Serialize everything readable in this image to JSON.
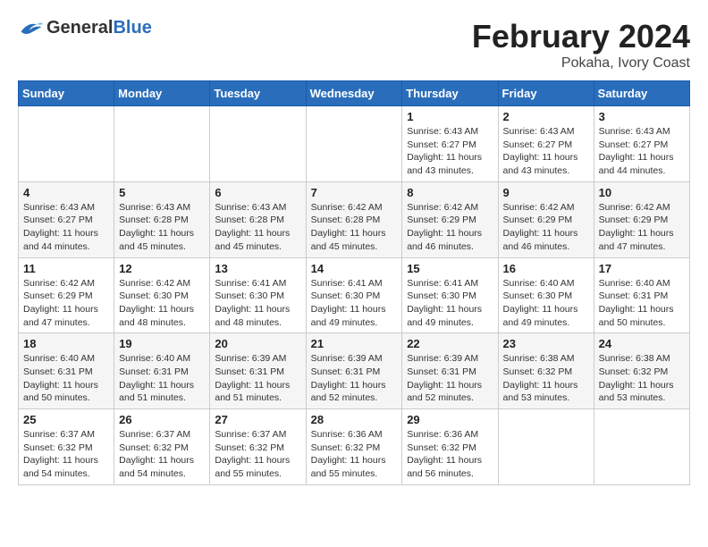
{
  "header": {
    "logo_general": "General",
    "logo_blue": "Blue",
    "month_title": "February 2024",
    "location": "Pokaha, Ivory Coast"
  },
  "calendar": {
    "days_of_week": [
      "Sunday",
      "Monday",
      "Tuesday",
      "Wednesday",
      "Thursday",
      "Friday",
      "Saturday"
    ],
    "weeks": [
      [
        {
          "day": "",
          "info": ""
        },
        {
          "day": "",
          "info": ""
        },
        {
          "day": "",
          "info": ""
        },
        {
          "day": "",
          "info": ""
        },
        {
          "day": "1",
          "info": "Sunrise: 6:43 AM\nSunset: 6:27 PM\nDaylight: 11 hours and 43 minutes."
        },
        {
          "day": "2",
          "info": "Sunrise: 6:43 AM\nSunset: 6:27 PM\nDaylight: 11 hours and 43 minutes."
        },
        {
          "day": "3",
          "info": "Sunrise: 6:43 AM\nSunset: 6:27 PM\nDaylight: 11 hours and 44 minutes."
        }
      ],
      [
        {
          "day": "4",
          "info": "Sunrise: 6:43 AM\nSunset: 6:27 PM\nDaylight: 11 hours and 44 minutes."
        },
        {
          "day": "5",
          "info": "Sunrise: 6:43 AM\nSunset: 6:28 PM\nDaylight: 11 hours and 45 minutes."
        },
        {
          "day": "6",
          "info": "Sunrise: 6:43 AM\nSunset: 6:28 PM\nDaylight: 11 hours and 45 minutes."
        },
        {
          "day": "7",
          "info": "Sunrise: 6:42 AM\nSunset: 6:28 PM\nDaylight: 11 hours and 45 minutes."
        },
        {
          "day": "8",
          "info": "Sunrise: 6:42 AM\nSunset: 6:29 PM\nDaylight: 11 hours and 46 minutes."
        },
        {
          "day": "9",
          "info": "Sunrise: 6:42 AM\nSunset: 6:29 PM\nDaylight: 11 hours and 46 minutes."
        },
        {
          "day": "10",
          "info": "Sunrise: 6:42 AM\nSunset: 6:29 PM\nDaylight: 11 hours and 47 minutes."
        }
      ],
      [
        {
          "day": "11",
          "info": "Sunrise: 6:42 AM\nSunset: 6:29 PM\nDaylight: 11 hours and 47 minutes."
        },
        {
          "day": "12",
          "info": "Sunrise: 6:42 AM\nSunset: 6:30 PM\nDaylight: 11 hours and 48 minutes."
        },
        {
          "day": "13",
          "info": "Sunrise: 6:41 AM\nSunset: 6:30 PM\nDaylight: 11 hours and 48 minutes."
        },
        {
          "day": "14",
          "info": "Sunrise: 6:41 AM\nSunset: 6:30 PM\nDaylight: 11 hours and 49 minutes."
        },
        {
          "day": "15",
          "info": "Sunrise: 6:41 AM\nSunset: 6:30 PM\nDaylight: 11 hours and 49 minutes."
        },
        {
          "day": "16",
          "info": "Sunrise: 6:40 AM\nSunset: 6:30 PM\nDaylight: 11 hours and 49 minutes."
        },
        {
          "day": "17",
          "info": "Sunrise: 6:40 AM\nSunset: 6:31 PM\nDaylight: 11 hours and 50 minutes."
        }
      ],
      [
        {
          "day": "18",
          "info": "Sunrise: 6:40 AM\nSunset: 6:31 PM\nDaylight: 11 hours and 50 minutes."
        },
        {
          "day": "19",
          "info": "Sunrise: 6:40 AM\nSunset: 6:31 PM\nDaylight: 11 hours and 51 minutes."
        },
        {
          "day": "20",
          "info": "Sunrise: 6:39 AM\nSunset: 6:31 PM\nDaylight: 11 hours and 51 minutes."
        },
        {
          "day": "21",
          "info": "Sunrise: 6:39 AM\nSunset: 6:31 PM\nDaylight: 11 hours and 52 minutes."
        },
        {
          "day": "22",
          "info": "Sunrise: 6:39 AM\nSunset: 6:31 PM\nDaylight: 11 hours and 52 minutes."
        },
        {
          "day": "23",
          "info": "Sunrise: 6:38 AM\nSunset: 6:32 PM\nDaylight: 11 hours and 53 minutes."
        },
        {
          "day": "24",
          "info": "Sunrise: 6:38 AM\nSunset: 6:32 PM\nDaylight: 11 hours and 53 minutes."
        }
      ],
      [
        {
          "day": "25",
          "info": "Sunrise: 6:37 AM\nSunset: 6:32 PM\nDaylight: 11 hours and 54 minutes."
        },
        {
          "day": "26",
          "info": "Sunrise: 6:37 AM\nSunset: 6:32 PM\nDaylight: 11 hours and 54 minutes."
        },
        {
          "day": "27",
          "info": "Sunrise: 6:37 AM\nSunset: 6:32 PM\nDaylight: 11 hours and 55 minutes."
        },
        {
          "day": "28",
          "info": "Sunrise: 6:36 AM\nSunset: 6:32 PM\nDaylight: 11 hours and 55 minutes."
        },
        {
          "day": "29",
          "info": "Sunrise: 6:36 AM\nSunset: 6:32 PM\nDaylight: 11 hours and 56 minutes."
        },
        {
          "day": "",
          "info": ""
        },
        {
          "day": "",
          "info": ""
        }
      ]
    ]
  }
}
